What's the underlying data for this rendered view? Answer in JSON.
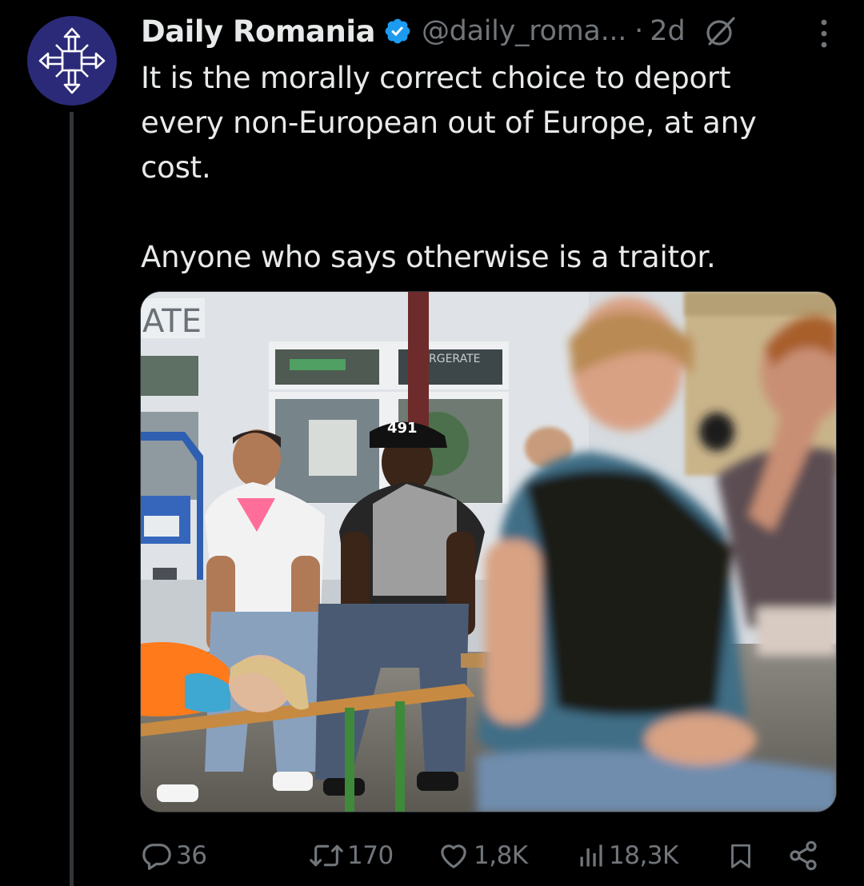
{
  "account": {
    "display_name": "Daily Romania",
    "handle": "@daily_roma...",
    "separator": "·",
    "timestamp": "2d",
    "avatar_icon": "cross-emblem-icon",
    "avatar_color": "#2b2a78",
    "verified_color": "#1d9bf0"
  },
  "post": {
    "paragraph_1": "It is the morally correct choice to deport every non-European out of Europe, at any cost.",
    "paragraph_2": "Anyone who says otherwise is a traitor."
  },
  "media": {
    "description_type": "photo",
    "sign_text_left": "ATE",
    "sign_text_right": "RGERATE",
    "cap_text": "491"
  },
  "actions": {
    "replies": "36",
    "reposts": "170",
    "likes": "1,8K",
    "views": "18,3K"
  },
  "colors": {
    "background": "#000000",
    "text_primary": "#e7e9ea",
    "text_secondary": "#71767b",
    "accent": "#1d9bf0"
  }
}
